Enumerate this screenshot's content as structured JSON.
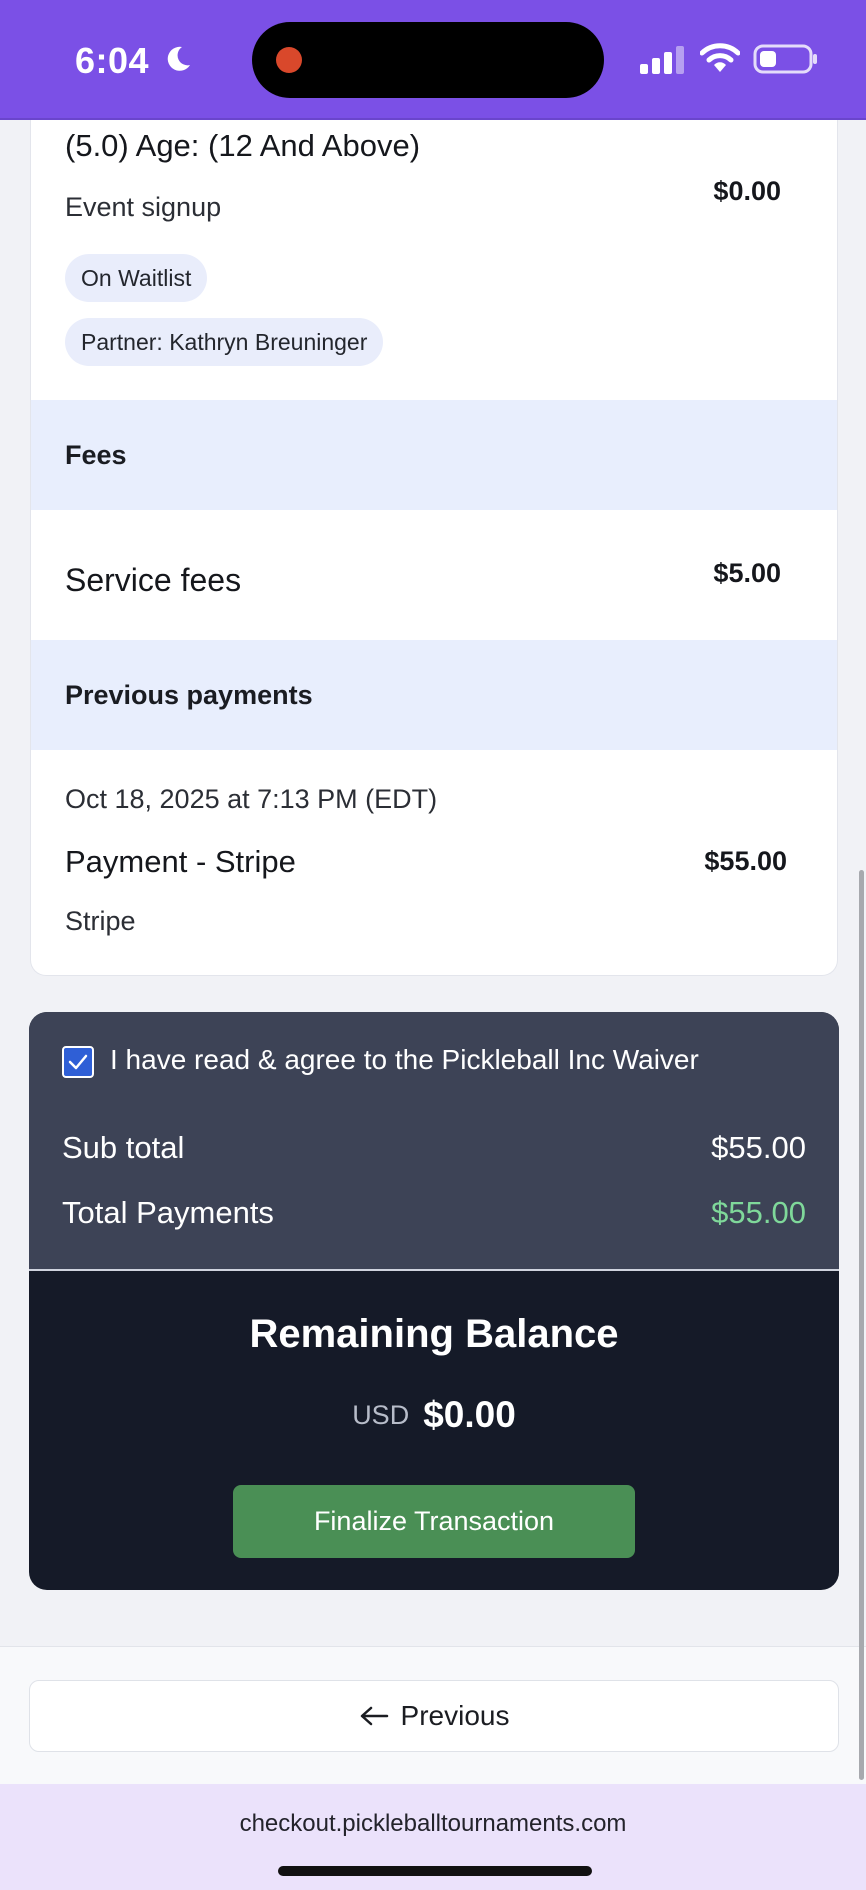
{
  "status_bar": {
    "time": "6:04",
    "icons": [
      "moon-icon",
      "signal-icon",
      "wifi-icon",
      "battery-icon"
    ]
  },
  "order": {
    "event_title": "(5.0) Age: (12 And Above)",
    "event_type": "Event signup",
    "event_price": "$0.00",
    "waitlist_badge": "On Waitlist",
    "partner_badge": "Partner: Kathryn Breuninger",
    "fees_heading": "Fees",
    "service_fees_label": "Service fees",
    "service_fees_amount": "$5.00",
    "previous_payments_heading": "Previous payments",
    "payment": {
      "date": "Oct 18, 2025 at 7:13 PM (EDT)",
      "title": "Payment - Stripe",
      "amount": "$55.00",
      "method": "Stripe"
    }
  },
  "summary": {
    "waiver_checked": true,
    "waiver_text": "I have read & agree to the Pickleball Inc Waiver",
    "subtotal_label": "Sub total",
    "subtotal_value": "$55.00",
    "total_payments_label": "Total Payments",
    "total_payments_value": "$55.00",
    "remaining_title": "Remaining Balance",
    "currency": "USD",
    "remaining_amount": "$0.00",
    "finalize_label": "Finalize Transaction"
  },
  "navigation": {
    "previous_label": "Previous"
  },
  "browser": {
    "url": "checkout.pickleballtournaments.com"
  },
  "colors": {
    "status_bar": "#7b50e6",
    "band": "#e8eefd",
    "summary_top": "#3d4356",
    "summary_bottom": "#151a28",
    "finalize_button": "#4a8f55",
    "payments_value": "#7fd89a",
    "url_bar": "#ebe2fb"
  }
}
